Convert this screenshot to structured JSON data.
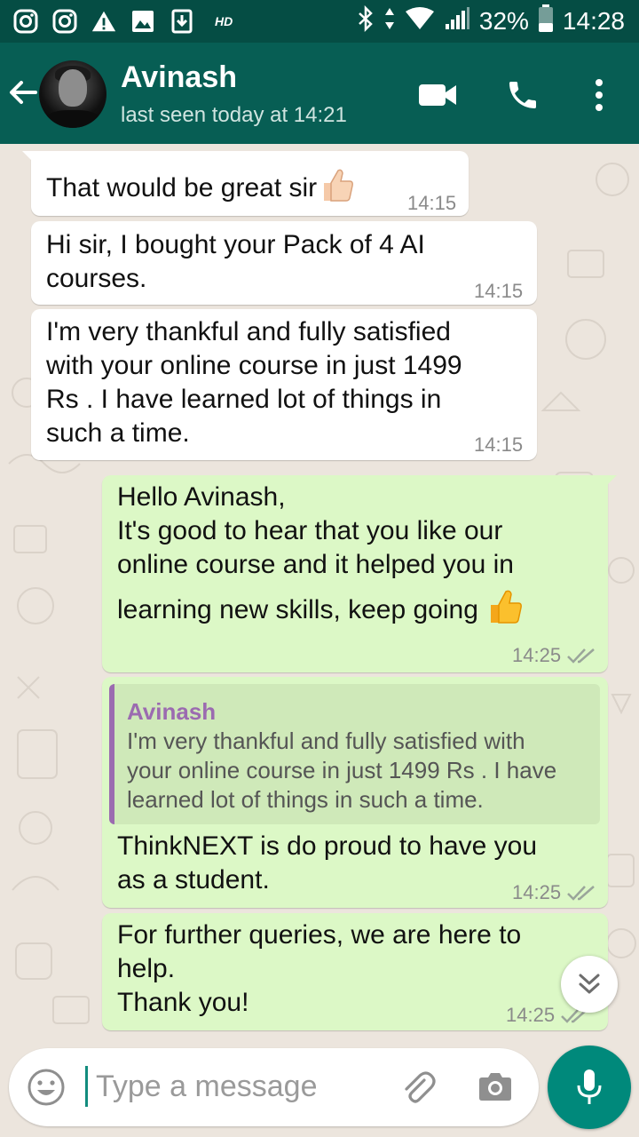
{
  "status_bar": {
    "hd_label": "HD",
    "battery": "32%",
    "time": "14:28"
  },
  "header": {
    "contact_name": "Avinash",
    "last_seen": "last seen today at 14:21"
  },
  "messages": [
    {
      "direction": "incoming",
      "text": "That would be great sir",
      "emoji": "thumbs-up",
      "time": "14:15"
    },
    {
      "direction": "incoming",
      "lines": [
        "Hi sir, I bought your Pack of 4 AI",
        "courses."
      ],
      "time": "14:15"
    },
    {
      "direction": "incoming",
      "lines": [
        "I'm very thankful and fully satisfied",
        "with your online course in just 1499",
        "Rs . I have learned lot of things in",
        "such a time."
      ],
      "time": "14:15"
    },
    {
      "direction": "outgoing",
      "lines": [
        "Hello Avinash,",
        "It's good to hear that you like our",
        "online course and it helped you in",
        "learning new skills, keep going"
      ],
      "emoji": "thumbs-up",
      "time": "14:25",
      "status": "read"
    },
    {
      "direction": "outgoing",
      "quote": {
        "author": "Avinash",
        "lines": [
          "I'm very thankful and fully satisfied with",
          "your online course in just 1499 Rs . I have",
          "learned lot of things in such a time."
        ]
      },
      "lines": [
        "ThinkNEXT is do proud to have you",
        "as a student."
      ],
      "time": "14:25",
      "status": "read"
    },
    {
      "direction": "outgoing",
      "lines": [
        "For further queries, we are here to",
        "help.",
        "Thank you!"
      ],
      "time": "14:25",
      "status": "read"
    }
  ],
  "composer": {
    "placeholder": "Type a message"
  },
  "colors": {
    "header": "#075e54",
    "status_bar": "#054d44",
    "outgoing_bubble": "#dcf8c6",
    "incoming_bubble": "#ffffff",
    "mic_button": "#00897b",
    "quote_accent": "#9b6bb0"
  }
}
